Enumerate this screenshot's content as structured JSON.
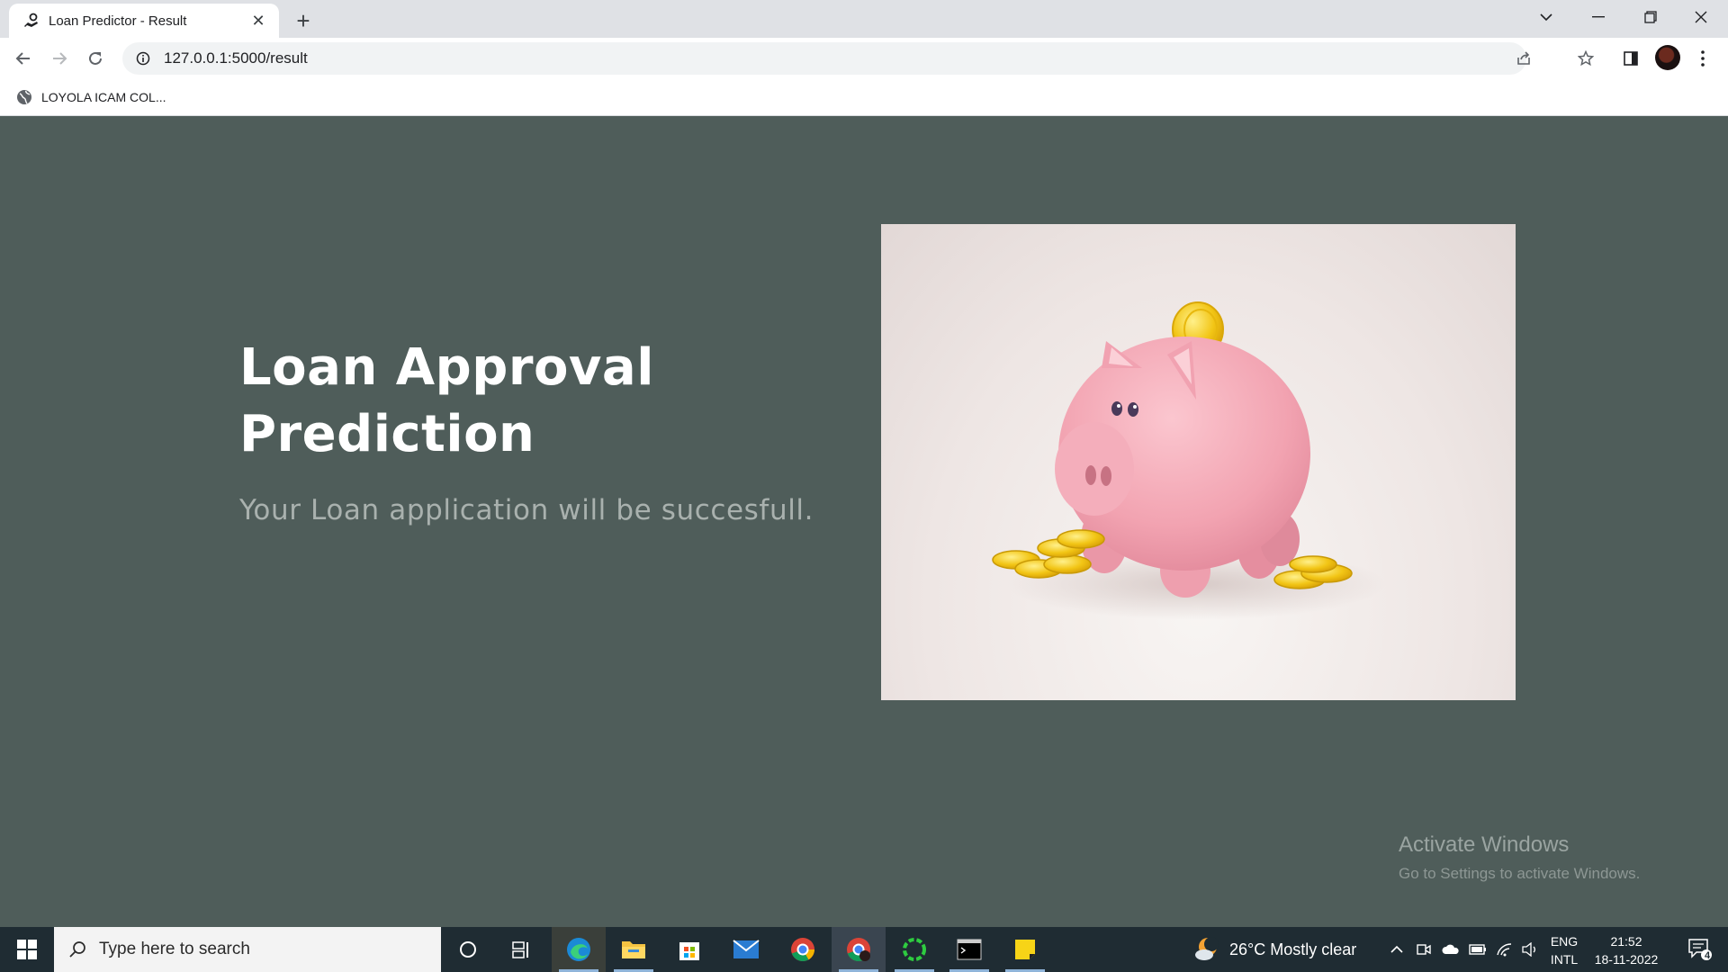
{
  "browser": {
    "tab_title": "Loan Predictor - Result",
    "url": "127.0.0.1:5000/result",
    "bookmarks": [
      {
        "label": "LOYOLA ICAM COL..."
      }
    ]
  },
  "page": {
    "title": "Loan Approval Prediction",
    "message": "Your Loan application will be succesfull.",
    "image": "piggy-bank-with-gold-coins"
  },
  "watermark": {
    "title": "Activate Windows",
    "subtitle": "Go to Settings to activate Windows."
  },
  "taskbar": {
    "search_placeholder": "Type here to search",
    "weather": "26°C  Mostly clear",
    "lang_line1": "ENG",
    "lang_line2": "INTL",
    "time": "21:52",
    "date": "18-11-2022",
    "notification_count": "4",
    "apps": [
      "cortana",
      "task-view",
      "edge",
      "file-explorer",
      "microsoft-store",
      "mail",
      "chrome",
      "chrome-profile",
      "spinner-app",
      "terminal",
      "sticky-notes"
    ]
  },
  "colors": {
    "page_bg": "#4f5d5a",
    "title": "#ffffff",
    "message": "#a9b1ae",
    "taskbar": "#1f2c33"
  }
}
